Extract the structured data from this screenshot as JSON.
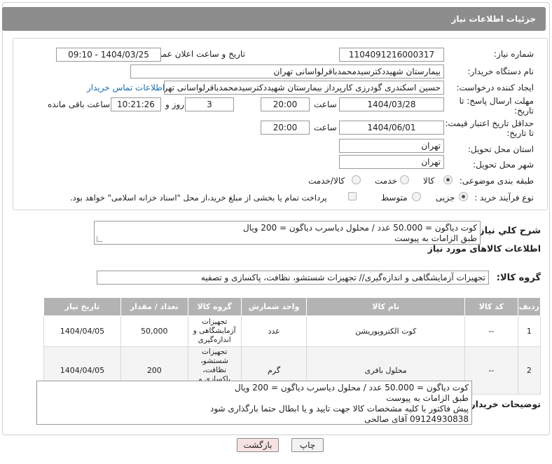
{
  "header": {
    "title": "جزئیات اطلاعات نیاز"
  },
  "fields": {
    "need_number_label": "شماره نیاز:",
    "need_number": "1104091216000317",
    "announce_label": "تاریخ و ساعت اعلان عمومی:",
    "announce_value": "1404/03/25 - 09:10",
    "buyer_org_label": "نام دستگاه خریدار:",
    "buyer_org": "بیمارستان شهیددکترسیدمحمدباقرلواسانی تهران",
    "creator_label": "ایجاد کننده درخواست:",
    "creator": "حسین اسکندری گودرزی کارپرداز بیمارستان شهیددکترسیدمحمدباقرلواسانی تهران",
    "contact_link": "اطلاعات تماس خریدار",
    "deadline_label_1": "مهلت ارسال پاسخ: تا",
    "deadline_label_2": "تاریخ:",
    "deadline_date": "1404/03/28",
    "time_label": "ساعت",
    "deadline_time": "20:00",
    "days_value": "3",
    "days_label": "روز و",
    "remaining_time": "10:21:26",
    "remaining_label": "ساعت باقی مانده",
    "validity_label_1": "حداقل تاریخ اعتبار قیمت:",
    "validity_label_2": "تا تاریخ:",
    "validity_date": "1404/06/01",
    "validity_time": "20:00",
    "province_label": "استان محل تحویل:",
    "province": "تهران",
    "city_label": "شهر محل تحویل:",
    "city": "تهران",
    "category_label": "طبقه بندی موضوعی:",
    "category_options": [
      "کالا",
      "خدمت",
      "کالا/خدمت"
    ],
    "category_selected": "کالا",
    "process_label": "نوع فرآیند خرید :",
    "process_options": [
      "جزیی",
      "متوسط"
    ],
    "process_selected": "جزیی",
    "payment_note": "پرداخت تمام یا بخشی از مبلغ خرید،از محل \"اسناد خزانه اسلامی\" خواهد بود."
  },
  "summary": {
    "label": "شرح کلي نياز:",
    "lines": [
      "کوت دیاگون = 50.000 عدد / محلول دیاسرب دیاگون = 200 ویال",
      "طبق الزامات به پیوست"
    ]
  },
  "goods": {
    "section_title": "اطلاعات کالاهای مورد نیاز",
    "group_label": "گروه کالا:",
    "group_value": "تجهیزات آزمایشگاهی و اندازه‌گیری// تجهیزات شستشو، نظافت، پاکسازی و تصفیه",
    "columns": [
      "ردیف",
      "کد کالا",
      "نام کالا",
      "واحد شمارش",
      "گروه کالا",
      "تعداد / مقدار",
      "تاریخ نیاز"
    ],
    "rows": [
      {
        "idx": "1",
        "code": "--",
        "name": "کوت الکتروپوریشن",
        "unit": "عدد",
        "group": "تجهیزات آزمایشگاهی و اندازه‌گیری",
        "qty": "50,000",
        "date": "1404/04/05"
      },
      {
        "idx": "2",
        "code": "--",
        "name": "محلول بافری",
        "unit": "گرم",
        "group": "تجهیزات شستشو، نظافت، پاکسازی و تصفیه",
        "qty": "200",
        "date": "1404/04/05"
      }
    ]
  },
  "buyer_notes": {
    "label": "توضیحات خریدار:",
    "lines": [
      "کوت دیاگون = 50.000 عدد / محلول دیاسرب دیاگون = 200 ویال",
      "طبق الزامات به پیوست",
      "پیش فاکتور با کلیه مشخصات کالا جهت تایید و یا ابطال حتما بارگذاری شود",
      "09124930838 آقای صالحی"
    ]
  },
  "buttons": {
    "print": "چاپ",
    "back": "بازگشت"
  }
}
